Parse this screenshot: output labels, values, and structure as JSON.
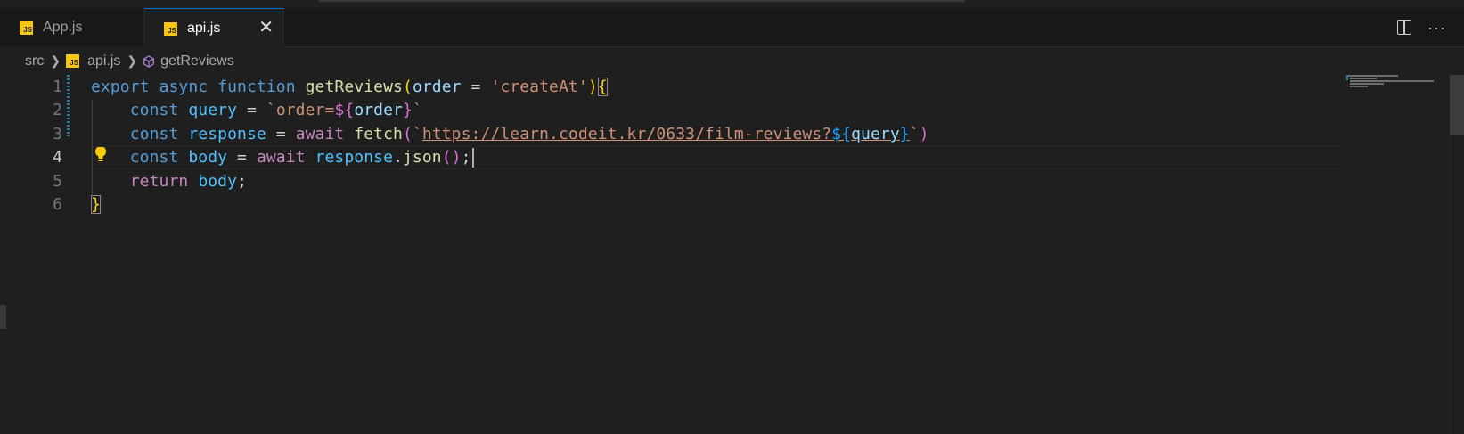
{
  "tabs": [
    {
      "label": "App.js",
      "icon": "js-file-icon",
      "active": false
    },
    {
      "label": "api.js",
      "icon": "js-file-icon",
      "active": true,
      "close_glyph": "✕"
    }
  ],
  "icon_label": "JS",
  "tab_actions": {
    "split": "split-editor-icon",
    "more": "···"
  },
  "breadcrumb": {
    "folder": "src",
    "file": "api.js",
    "symbol": "getReviews"
  },
  "line_numbers": [
    "1",
    "2",
    "3",
    "4",
    "5",
    "6"
  ],
  "current_line": "4",
  "code": {
    "l1": {
      "export": "export",
      "async": "async",
      "function": "function",
      "name": "getReviews",
      "open": "(",
      "param": "order",
      "eq": " = ",
      "default": "'createAt'",
      "close": ")",
      "brace": "{"
    },
    "l2": {
      "const": "const",
      "var": "query",
      "eq": " = ",
      "tick_open": "`",
      "text": "order=",
      "interp_open": "${",
      "interp_var": "order",
      "interp_close": "}",
      "tick_close": "`"
    },
    "l3": {
      "const": "const",
      "var": "response",
      "eq": " = ",
      "await": "await",
      "fn": "fetch",
      "open": "(",
      "tick_open": "`",
      "url": "https://learn.codeit.kr/0633/film-reviews?",
      "interp_open": "${",
      "interp_var": "query",
      "interp_close": "}",
      "tick_close": "`",
      "close": ")"
    },
    "l4": {
      "const": "const",
      "var": "body",
      "eq": " = ",
      "await": "await",
      "obj": "response",
      "dot": ".",
      "method": "json",
      "parens": "()",
      "semi": ";"
    },
    "l5": {
      "return": "return",
      "var": "body",
      "semi": ";"
    },
    "l6": {
      "brace": "}"
    }
  },
  "colors": {
    "background": "#1f1f1f",
    "tabbar": "#181818",
    "accent": "#0078d4",
    "js_icon": "#f5c518"
  }
}
